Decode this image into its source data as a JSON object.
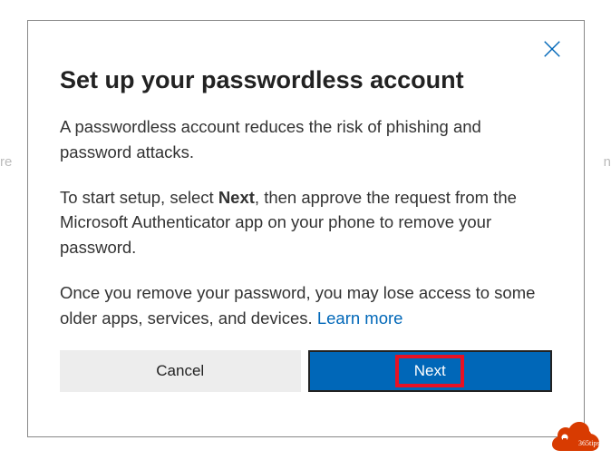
{
  "dialog": {
    "title": "Set up your passwordless account",
    "paragraph1": "A passwordless account reduces the risk of phishing and password attacks.",
    "paragraph2_pre": "To start setup, select ",
    "paragraph2_bold": "Next",
    "paragraph2_post": ", then approve the request from the Microsoft Authenticator app on your phone to remove your password.",
    "paragraph3_text": "Once you remove your password, you may lose access to some older apps, services, and devices. ",
    "learn_more": "Learn more",
    "cancel_label": "Cancel",
    "next_label": "Next"
  },
  "watermark": {
    "label": "365tips"
  },
  "colors": {
    "primary": "#0067b8",
    "highlight": "#e81123",
    "watermark": "#d83b01"
  }
}
